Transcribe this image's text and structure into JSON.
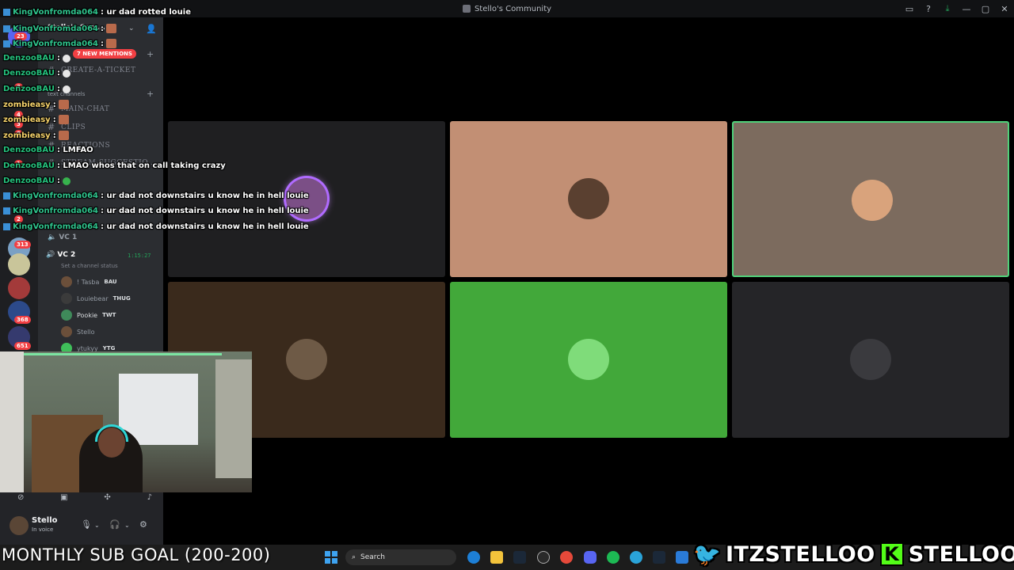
{
  "window": {
    "title": "Stello's Community",
    "controls": [
      "▭",
      "?",
      "⤓",
      "—",
      "▢",
      "✕"
    ]
  },
  "server_rail": {
    "badges": [
      "23",
      "8",
      "4",
      "3",
      "8",
      "1",
      "2",
      "313",
      "368",
      "651"
    ]
  },
  "sidebar": {
    "server_name": "Stello's Com...",
    "new_mentions": "7 NEW MENTIONS",
    "channels": [
      "CREATE-A-TICKET",
      "MAIN-CHAT",
      "CLIPS",
      "REACTIONS",
      "STREAM-SUGGESTIO..."
    ],
    "category_text": "text channels",
    "vc1": "VC 1",
    "vc2": "VC 2",
    "vc2_time": "1:15:27",
    "vc2_status": "Set a channel status",
    "voice_users": [
      {
        "name": "! Tasba",
        "tag": "BAU"
      },
      {
        "name": "Louiebear",
        "tag": "THUG"
      },
      {
        "name": "Pookie",
        "tag": "TWT"
      },
      {
        "name": "Stello",
        "tag": ""
      },
      {
        "name": "ytukyy",
        "tag": "YTG"
      }
    ]
  },
  "user_panel": {
    "name": "Stello",
    "status": "In voice"
  },
  "chat": [
    {
      "user": "KingVonfromda064",
      "message": ": ur dad rotted louie",
      "style": "k"
    },
    {
      "user": "KingVonfromda064",
      "message": ":",
      "style": "k"
    },
    {
      "user": "KingVonfromda064",
      "message": ":",
      "style": "k"
    },
    {
      "user": "DenzooBAU",
      "message": ":",
      "style": "d"
    },
    {
      "user": "DenzooBAU",
      "message": ":",
      "style": "d"
    },
    {
      "user": "DenzooBAU",
      "message": ":",
      "style": "d"
    },
    {
      "user": "zombieasy",
      "message": ":",
      "style": "z"
    },
    {
      "user": "zombieasy",
      "message": ":",
      "style": "z"
    },
    {
      "user": "zombieasy",
      "message": ":",
      "style": "z"
    },
    {
      "user": "DenzooBAU",
      "message": ": LMFAO",
      "style": "d"
    },
    {
      "user": "DenzooBAU",
      "message": ": LMAO whos that on call taking crazy",
      "style": "d"
    },
    {
      "user": "DenzooBAU",
      "message": ":",
      "style": "d"
    },
    {
      "user": "KingVonfromda064",
      "message": ": ur dad not downstairs u know he in hell louie",
      "style": "k"
    },
    {
      "user": "KingVonfromda064",
      "message": ": ur dad not downstairs u know he in hell louie",
      "style": "k"
    },
    {
      "user": "KingVonfromda064",
      "message": ": ur dad not downstairs u know he in hell louie",
      "style": "k"
    }
  ],
  "taskbar": {
    "search_label": "Search"
  },
  "overlay": {
    "sub_goal": "MONTHLY SUB GOAL (200-200)",
    "twitter": "ITZSTELLOO",
    "kick": "STELLOOO",
    "kick_letter": "K"
  },
  "colors": {
    "accent_green": "#23a55a",
    "mention_red": "#f23f43",
    "tile_green": "#42a83a",
    "speaking_border": "#4fd17a",
    "kick_green": "#53fc18"
  }
}
